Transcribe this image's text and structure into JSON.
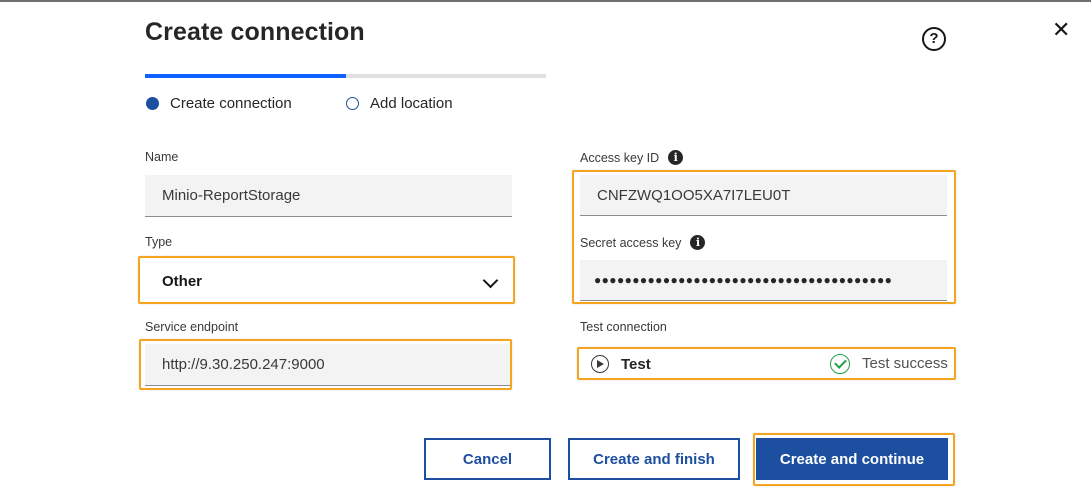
{
  "dialog": {
    "title": "Create connection",
    "help_icon": "help-icon",
    "close_icon": "close-icon",
    "help_glyph": "?",
    "close_glyph": "✕"
  },
  "progress": {
    "completed_fraction": 0.5
  },
  "steps": [
    {
      "label": "Create connection",
      "state": "current"
    },
    {
      "label": "Add location",
      "state": "upcoming"
    }
  ],
  "form": {
    "name": {
      "label": "Name",
      "value": "Minio-ReportStorage"
    },
    "type": {
      "label": "Type",
      "selected": "Other"
    },
    "service_endpoint": {
      "label": "Service endpoint",
      "value": "http://9.30.250.247:9000"
    },
    "access_key_id": {
      "label": "Access key ID",
      "value": "CNFZWQ1OO5XA7I7LEU0T"
    },
    "secret_access_key": {
      "label": "Secret access key",
      "value": "●●●●●●●●●●●●●●●●●●●●●●●●●●●●●●●●●●●●●●●"
    },
    "info_glyph": "i"
  },
  "test_connection": {
    "label": "Test connection",
    "button_label": "Test",
    "status": "Test success"
  },
  "buttons": {
    "cancel": "Cancel",
    "create_finish": "Create and finish",
    "create_continue": "Create and continue"
  },
  "colors": {
    "accent": "#1d4fa0",
    "highlight": "#f4a41e",
    "success": "#24a148",
    "progress": "#0f62fe"
  }
}
